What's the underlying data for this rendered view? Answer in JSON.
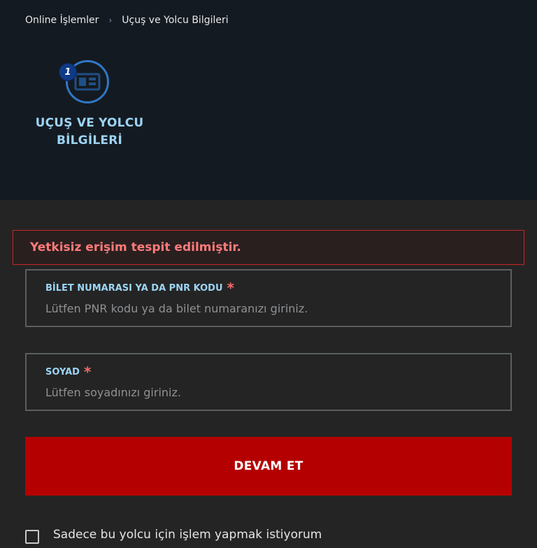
{
  "breadcrumb": {
    "items": [
      "Online İşlemler",
      "Uçuş ve Yolcu Bilgileri"
    ],
    "separator": "›"
  },
  "stepper": {
    "step_number": "1",
    "step_label": "UÇUŞ VE YOLCU BİLGİLERİ",
    "icon": "boarding-pass-icon"
  },
  "alert": {
    "message": "Yetkisiz erişim tespit edilmiştir."
  },
  "form": {
    "pnr_label": "BİLET NUMARASI YA DA PNR KODU",
    "pnr_placeholder": "Lütfen PNR kodu ya da bilet numaranızı giriniz.",
    "surname_label": "SOYAD",
    "surname_placeholder": "Lütfen soyadınızı giriniz.",
    "required_marker": "*",
    "submit_label": "DEVAM ET",
    "single_passenger_label": "Sadece bu yolcu için işlem yapmak istiyorum"
  },
  "colors": {
    "header_bg": "#141a21",
    "page_bg": "#242424",
    "accent_blue": "#9cd4f4",
    "alert_red": "#ff7b7b",
    "button_red": "#b40000"
  }
}
